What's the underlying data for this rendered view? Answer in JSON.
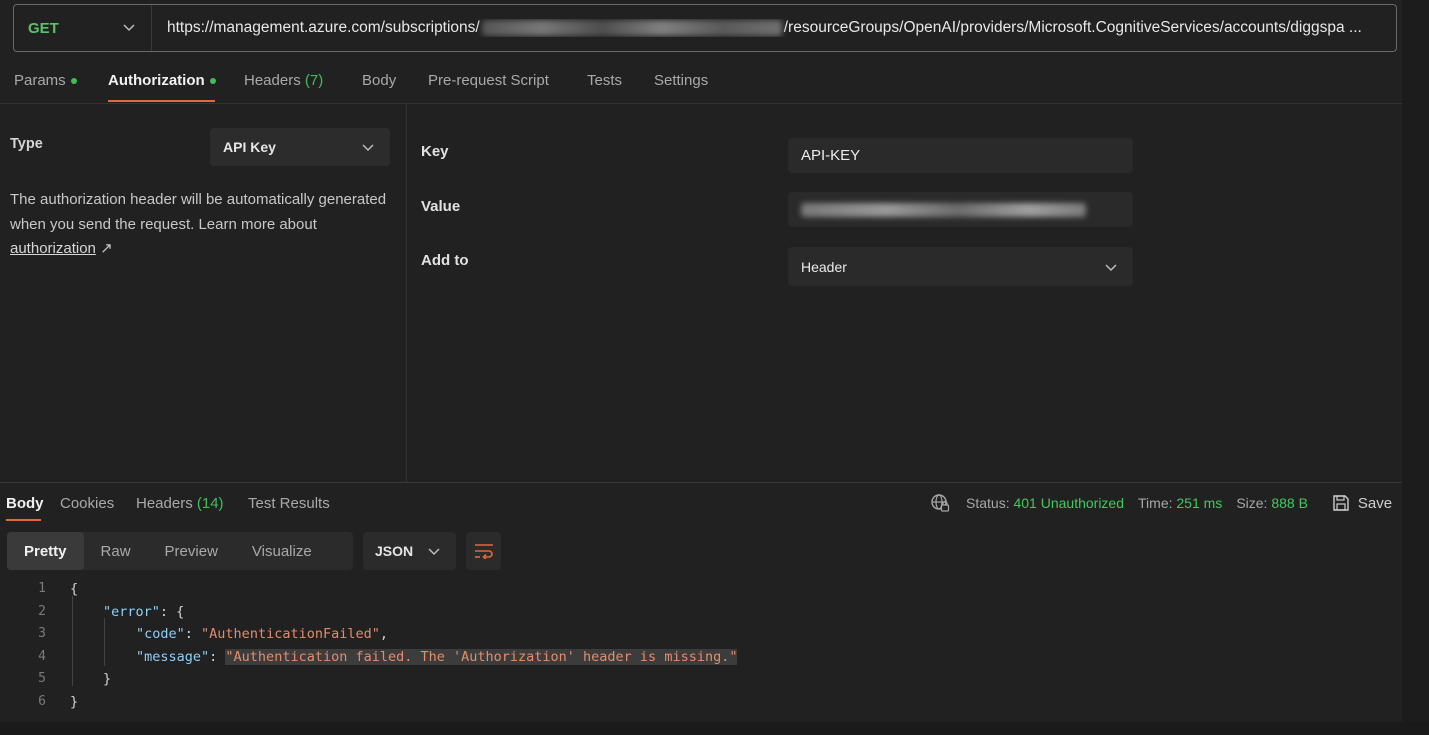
{
  "request": {
    "method": "GET",
    "url_prefix": "https://management.azure.com/subscriptions/",
    "url_suffix": "/resourceGroups/OpenAI/providers/Microsoft.CognitiveServices/accounts/diggspa ..."
  },
  "request_tabs": {
    "params": "Params",
    "authorization": "Authorization",
    "headers": "Headers",
    "headers_count": "(7)",
    "body": "Body",
    "prerequest": "Pre-request Script",
    "tests": "Tests",
    "settings": "Settings"
  },
  "auth": {
    "type_label": "Type",
    "type_value": "API Key",
    "description": "The authorization header will be automatically generated when you send the request. Learn more about ",
    "link_text": "authorization",
    "link_arrow": "↗",
    "key_label": "Key",
    "key_value": "API-KEY",
    "value_label": "Value",
    "addto_label": "Add to",
    "addto_value": "Header"
  },
  "response_tabs": {
    "body": "Body",
    "cookies": "Cookies",
    "headers": "Headers",
    "headers_count": "(14)",
    "test_results": "Test Results"
  },
  "status": {
    "status_label": "Status:",
    "status_value": "401 Unauthorized",
    "time_label": "Time:",
    "time_value": "251 ms",
    "size_label": "Size:",
    "size_value": "888 B",
    "save_label": "Save"
  },
  "view": {
    "pretty": "Pretty",
    "raw": "Raw",
    "preview": "Preview",
    "visualize": "Visualize",
    "format": "JSON"
  },
  "code": {
    "line_numbers": [
      "1",
      "2",
      "3",
      "4",
      "5",
      "6"
    ],
    "open_brace": "{",
    "error_key": "\"error\"",
    "error_open": ": {",
    "code_key": "\"code\"",
    "code_colon": ": ",
    "code_value": "\"AuthenticationFailed\"",
    "code_comma": ",",
    "message_key": "\"message\"",
    "message_colon": ": ",
    "message_value": "\"Authentication failed. The 'Authorization' header is missing.\"",
    "inner_close": "}",
    "outer_close": "}"
  },
  "colors": {
    "accent": "#e2683c",
    "success": "#45c85f",
    "method_get": "#5cc26a"
  }
}
